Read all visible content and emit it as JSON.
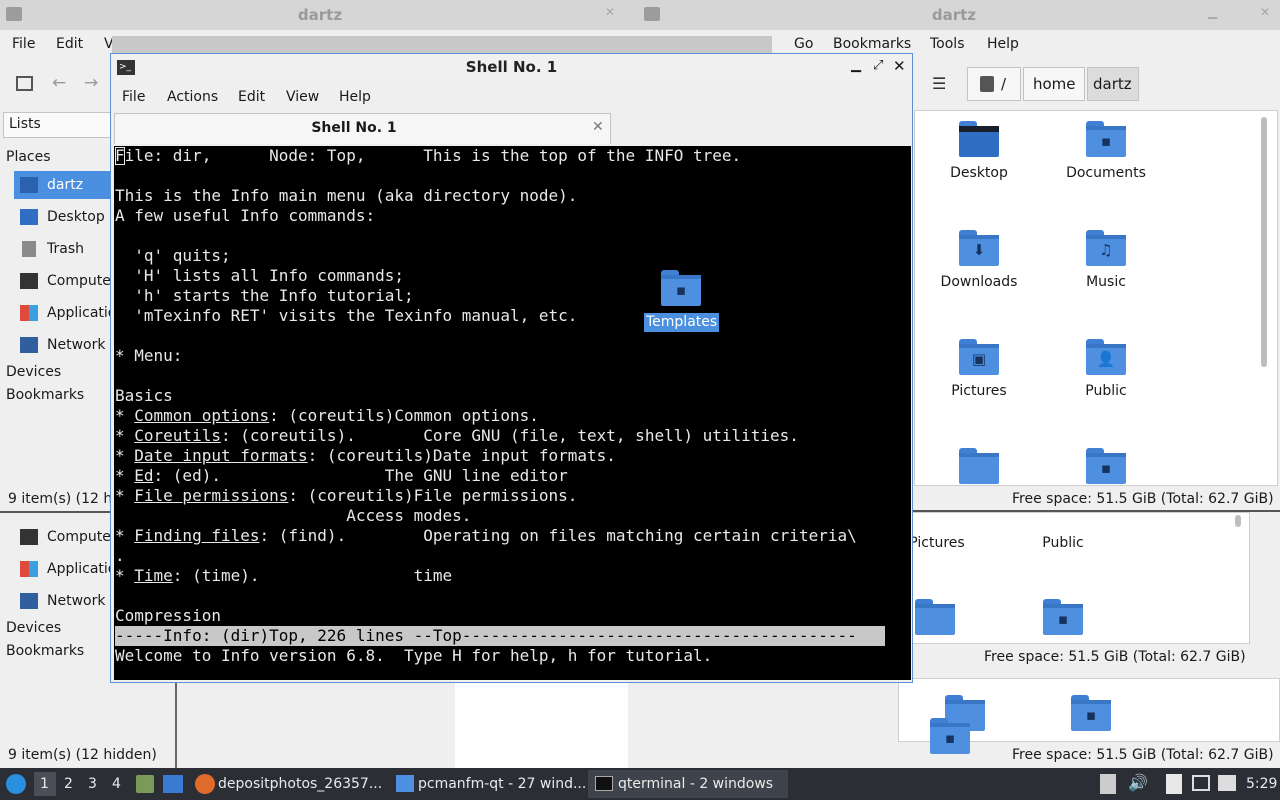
{
  "windows": {
    "fm_left": {
      "title": "dartz",
      "menu": [
        "File",
        "Edit",
        "V"
      ],
      "lists_label": "Lists",
      "places_heading": "Places",
      "places": [
        "dartz",
        "Desktop",
        "Trash",
        "Compute",
        "Applicatio",
        "Network"
      ],
      "devices_heading": "Devices",
      "bookmarks_heading": "Bookmarks",
      "status": "9 item(s) (12 hid",
      "lower_places": [
        "Compute",
        "Applicatio",
        "Network"
      ],
      "lower_devices_heading": "Devices",
      "lower_bookmarks_heading": "Bookmarks",
      "lower_status": "9 item(s) (12 hidden)"
    },
    "fm_right": {
      "title": "dartz",
      "menu": [
        "Go",
        "Bookmarks",
        "Tools",
        "Help"
      ],
      "path_root": "/",
      "path_parts": [
        "home",
        "dartz"
      ],
      "items": [
        {
          "label": "Desktop",
          "glyph": ""
        },
        {
          "label": "Documents",
          "glyph": "▪"
        },
        {
          "label": "Downloads",
          "glyph": "⬇"
        },
        {
          "label": "Music",
          "glyph": "♫"
        },
        {
          "label": "Pictures",
          "glyph": "▣"
        },
        {
          "label": "Public",
          "glyph": "👤"
        }
      ],
      "free_space": "Free space: 51.5 GiB (Total: 62.7 GiB)",
      "lower_items": [
        "Pictures",
        "Public"
      ],
      "lower_free_space": "Free space: 51.5 GiB (Total: 62.7 GiB)",
      "bottom_free_space": "Free space: 51.5 GiB (Total: 62.7 GiB)"
    },
    "terminal": {
      "title": "Shell No. 1",
      "menu": [
        "File",
        "Actions",
        "Edit",
        "View",
        "Help"
      ],
      "tab_label": "Shell No. 1",
      "lines": [
        "File: dir,      Node: Top,      This is the top of the INFO tree.",
        "",
        "This is the Info main menu (aka directory node).",
        "A few useful Info commands:",
        "",
        "  'q' quits;",
        "  'H' lists all Info commands;",
        "  'h' starts the Info tutorial;",
        "  'mTexinfo RET' visits the Texinfo manual, etc.",
        "",
        "* Menu:",
        "",
        "Basics"
      ],
      "menu_entries": [
        {
          "name": "Common options",
          "rest": ": (coreutils)Common options."
        },
        {
          "name": "Coreutils",
          "rest": ": (coreutils).       Core GNU (file, text, shell) utilities."
        },
        {
          "name": "Date input formats",
          "rest": ": (coreutils)Date input formats."
        },
        {
          "name": "Ed",
          "rest": ": (ed).                 The GNU line editor"
        },
        {
          "name": "File permissions",
          "rest": ": (coreutils)File permissions."
        }
      ],
      "continuation1": "                        Access modes.",
      "menu_entry_find": {
        "name": "Finding files",
        "rest": ": (find).        Operating on files matching certain criteria\\"
      },
      "continuation2": ".",
      "menu_entry_time": {
        "name": "Time",
        "rest": ": (time).                time"
      },
      "blank": "",
      "compression": "Compression",
      "status_line": "-----Info: (dir)Top, 226 lines --Top-----------------------------------------",
      "echo_line": "Welcome to Info version 6.8.  Type H for help, h for tutorial."
    }
  },
  "desktop": {
    "templates_label": "Templates"
  },
  "taskbar": {
    "workspaces": [
      "1",
      "2",
      "3",
      "4"
    ],
    "tasks": [
      "depositphotos_26357...",
      "pcmanfm-qt - 27 wind...",
      "qterminal - 2 windows"
    ],
    "clock": "5:29"
  },
  "colors": {
    "accent": "#4a8fe0",
    "terminal_bg": "#000000",
    "taskbar_bg": "#2b2f35"
  }
}
